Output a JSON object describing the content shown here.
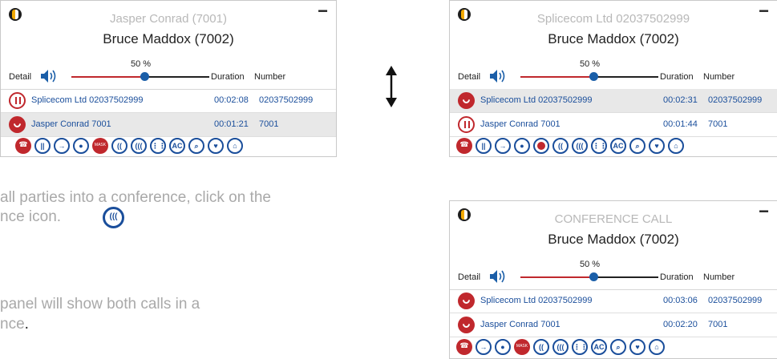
{
  "panels": [
    {
      "header_line1": "Jasper Conrad (7001)",
      "header_line2": "Bruce Maddox (7002)",
      "minimize_label": "−",
      "detail_label": "Detail",
      "volume_percent": "50 %",
      "col_duration": "Duration",
      "col_number": "Number",
      "rows": [
        {
          "status": "hold",
          "name": "Splicecom Ltd 02037502999",
          "duration": "00:02:08",
          "number": "02037502999"
        },
        {
          "status": "active",
          "name": "Jasper Conrad 7001",
          "duration": "00:01:21",
          "number": "7001"
        }
      ],
      "toolbar": [
        "hangup-icon",
        "hold-icon",
        "transfer-icon",
        "record-icon",
        "mask-icon",
        "conference-2-icon",
        "conference-3-icon",
        "keypad-icon",
        "ac-icon",
        "search-icon",
        "favorite-icon",
        "home-icon"
      ]
    },
    {
      "header_line1": "Splicecom Ltd 02037502999",
      "header_line2": "Bruce Maddox (7002)",
      "minimize_label": "−",
      "detail_label": "Detail",
      "volume_percent": "50 %",
      "col_duration": "Duration",
      "col_number": "Number",
      "rows": [
        {
          "status": "active",
          "name": "Splicecom Ltd 02037502999",
          "duration": "00:02:31",
          "number": "02037502999"
        },
        {
          "status": "hold",
          "name": "Jasper Conrad 7001",
          "duration": "00:01:44",
          "number": "7001"
        }
      ],
      "toolbar": [
        "hangup-icon",
        "hold-icon",
        "transfer-icon",
        "record-icon",
        "record-red-icon",
        "conference-2-icon",
        "conference-3-icon",
        "keypad-icon",
        "ac-icon",
        "search-icon",
        "favorite-icon",
        "home-icon"
      ]
    },
    {
      "header_line1": "CONFERENCE CALL",
      "header_line2": "Bruce Maddox (7002)",
      "minimize_label": "−",
      "detail_label": "Detail",
      "volume_percent": "50 %",
      "col_duration": "Duration",
      "col_number": "Number",
      "rows": [
        {
          "status": "active",
          "name": "Splicecom Ltd 02037502999",
          "duration": "00:03:06",
          "number": "02037502999"
        },
        {
          "status": "active",
          "name": "Jasper Conrad 7001",
          "duration": "00:02:20",
          "number": "7001"
        }
      ],
      "toolbar": [
        "hangup-icon",
        "transfer-icon",
        "record-icon",
        "mask-icon",
        "conference-2-icon",
        "conference-3-icon",
        "keypad-icon",
        "ac-icon",
        "search-icon",
        "favorite-icon",
        "home-icon"
      ]
    }
  ],
  "instructions": {
    "line1": "all parties into a conference, click on the",
    "line2": "nce icon.",
    "line3": "panel will show both calls in a",
    "line4": "nce",
    "line4_end": "."
  },
  "glyphs": {
    "mask": "MASK",
    "ac": "AC",
    "conf2": "((",
    "conf3": "(((",
    "conf_big": "((("
  },
  "colors": {
    "accent_blue": "#1a4e9b",
    "call_red": "#c0282d"
  }
}
